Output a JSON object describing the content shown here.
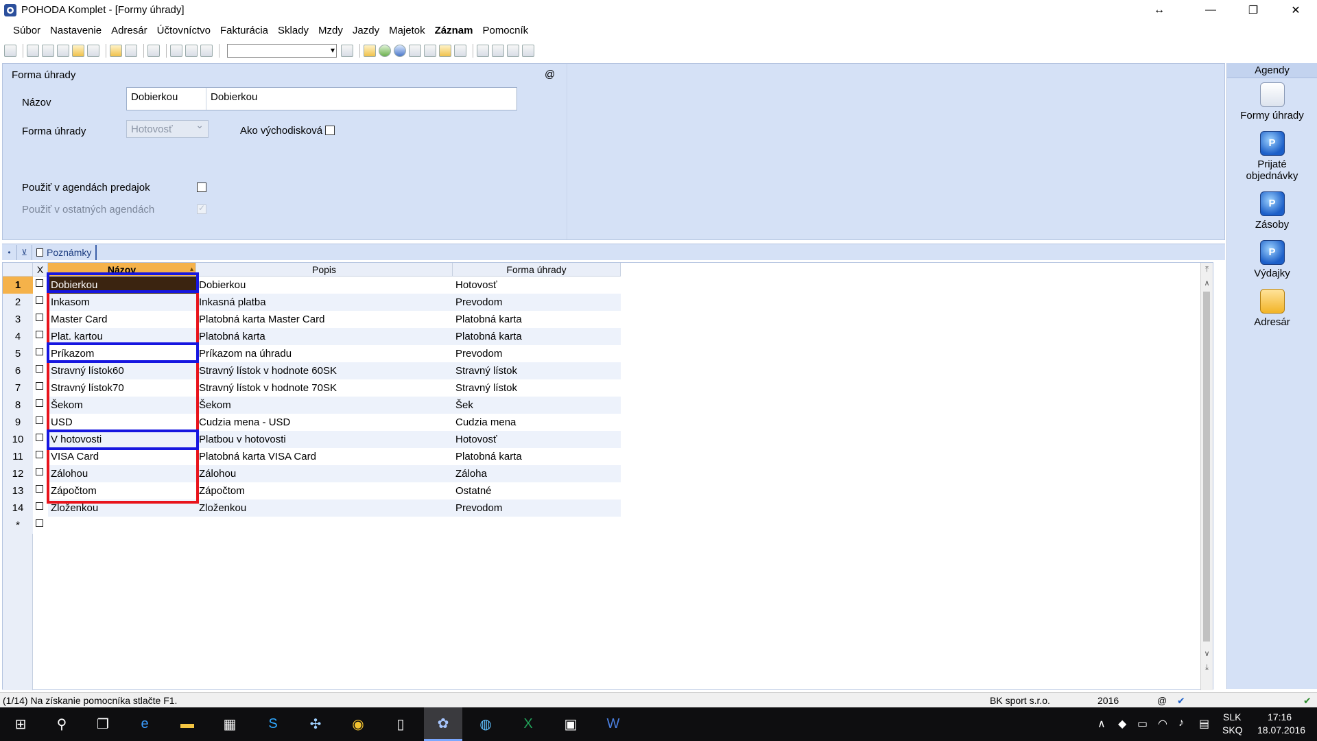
{
  "window": {
    "title": "POHODA Komplet - [Formy úhrady]",
    "resize_glyph": "↔",
    "minimize_glyph": "—",
    "restore_glyph": "❐",
    "close_glyph": "✕"
  },
  "menu": [
    "Súbor",
    "Nastavenie",
    "Adresár",
    "Účtovníctvo",
    "Fakturácia",
    "Sklady",
    "Mzdy",
    "Jazdy",
    "Majetok",
    "Záznam",
    "Pomocník"
  ],
  "form": {
    "section_title": "Forma úhrady",
    "at_sign": "@",
    "nazov_label": "Názov",
    "nazov_code": "Dobierkou",
    "nazov_full": "Dobierkou",
    "forma_label": "Forma úhrady",
    "forma_value": "Hotovosť",
    "default_label": "Ako východisková",
    "use_sales_label": "Použiť v agendách predajok",
    "use_other_label": "Použiť v ostatných agendách"
  },
  "tabs": {
    "notes_label": "Poznámky",
    "star_glyph": "•",
    "filter_glyph": "⊻"
  },
  "grid": {
    "columns": {
      "x": "X",
      "name": "Názov",
      "desc": "Popis",
      "method": "Forma úhrady"
    },
    "new_row_marker": "*",
    "rows": [
      {
        "n": "1",
        "name": "Dobierkou",
        "desc": "Dobierkou",
        "method": "Hotovosť"
      },
      {
        "n": "2",
        "name": "Inkasom",
        "desc": "Inkasná platba",
        "method": "Prevodom"
      },
      {
        "n": "3",
        "name": "Master Card",
        "desc": "Platobná karta Master Card",
        "method": "Platobná karta"
      },
      {
        "n": "4",
        "name": "Plat. kartou",
        "desc": "Platobná karta",
        "method": "Platobná karta"
      },
      {
        "n": "5",
        "name": "Príkazom",
        "desc": "Príkazom na úhradu",
        "method": "Prevodom"
      },
      {
        "n": "6",
        "name": "Stravný lístok60",
        "desc": "Stravný lístok v hodnote 60SK",
        "method": "Stravný lístok"
      },
      {
        "n": "7",
        "name": "Stravný lístok70",
        "desc": "Stravný lístok v hodnote 70SK",
        "method": "Stravný lístok"
      },
      {
        "n": "8",
        "name": "Šekom",
        "desc": "Šekom",
        "method": "Šek"
      },
      {
        "n": "9",
        "name": "USD",
        "desc": "Cudzia mena - USD",
        "method": "Cudzia mena"
      },
      {
        "n": "10",
        "name": "V hotovosti",
        "desc": "Platbou v hotovosti",
        "method": "Hotovosť"
      },
      {
        "n": "11",
        "name": "VISA Card",
        "desc": "Platobná karta VISA Card",
        "method": "Platobná karta"
      },
      {
        "n": "12",
        "name": "Zálohou",
        "desc": "Zálohou",
        "method": "Záloha"
      },
      {
        "n": "13",
        "name": "Zápočtom",
        "desc": "Zápočtom",
        "method": "Ostatné"
      },
      {
        "n": "14",
        "name": "Zloženkou",
        "desc": "Zloženkou",
        "method": "Prevodom"
      }
    ]
  },
  "agendy": {
    "title": "Agendy",
    "items": [
      {
        "label": "Formy úhrady",
        "icon": "form-icon"
      },
      {
        "label": "Prijaté objednávky",
        "icon": "blue-p-icon"
      },
      {
        "label": "Zásoby",
        "icon": "blue-p-icon"
      },
      {
        "label": "Výdajky",
        "icon": "blue-p-icon"
      },
      {
        "label": "Adresár",
        "icon": "book-icon"
      }
    ]
  },
  "status": {
    "left": "(1/14) Na získanie pomocníka stlačte F1.",
    "company": "BK sport  s.r.o.",
    "year": "2016",
    "at": "@"
  },
  "taskbar": {
    "lang1": "SLK",
    "lang2": "SKQ",
    "time": "17:16",
    "date": "18.07.2016"
  }
}
